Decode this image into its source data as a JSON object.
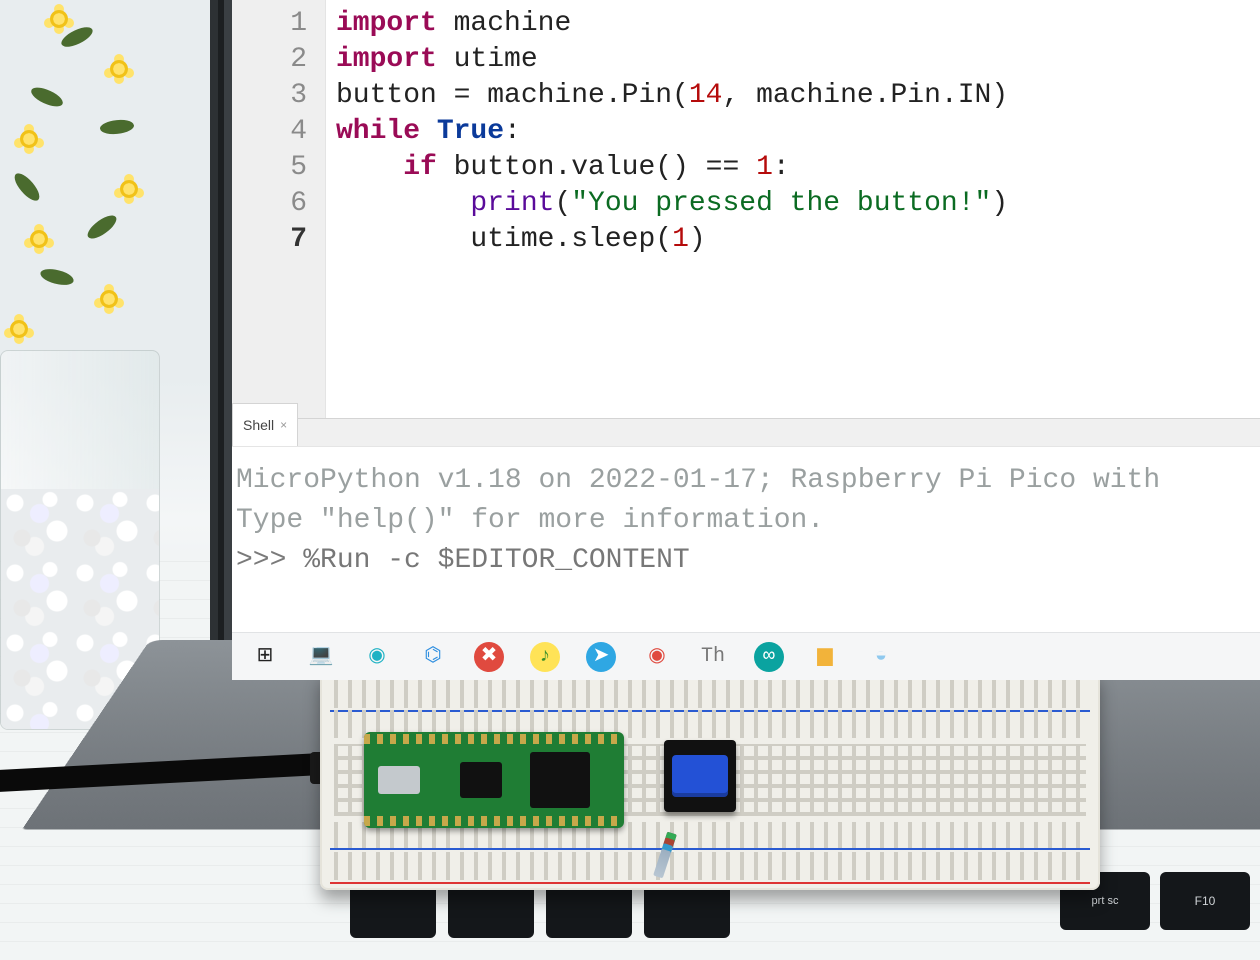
{
  "editor": {
    "current_line": 7,
    "lines": [
      {
        "n": 1,
        "tokens": [
          [
            "kw",
            "import"
          ],
          [
            "",
            " machine"
          ]
        ]
      },
      {
        "n": 2,
        "tokens": [
          [
            "kw",
            "import"
          ],
          [
            "",
            " utime"
          ]
        ]
      },
      {
        "n": 3,
        "tokens": [
          [
            "",
            "button = machine.Pin("
          ],
          [
            "num",
            "14"
          ],
          [
            "",
            ", machine.Pin.IN)"
          ]
        ]
      },
      {
        "n": 4,
        "tokens": [
          [
            "kw",
            "while"
          ],
          [
            "",
            " "
          ],
          [
            "bkw",
            "True"
          ],
          [
            "",
            ":"
          ]
        ]
      },
      {
        "n": 5,
        "tokens": [
          [
            "",
            "    "
          ],
          [
            "kw",
            "if"
          ],
          [
            "",
            " button.value() == "
          ],
          [
            "num",
            "1"
          ],
          [
            "",
            ":"
          ]
        ]
      },
      {
        "n": 6,
        "tokens": [
          [
            "",
            "        "
          ],
          [
            "fn",
            "print"
          ],
          [
            "",
            "("
          ],
          [
            "str",
            "\"You pressed the button!\""
          ],
          [
            "",
            ")"
          ]
        ]
      },
      {
        "n": 7,
        "tokens": [
          [
            "",
            "        utime.sleep("
          ],
          [
            "num",
            "1"
          ],
          [
            "",
            ")"
          ]
        ]
      }
    ]
  },
  "shell": {
    "tab_label": "Shell",
    "banner1": "MicroPython v1.18 on 2022-01-17; Raspberry Pi Pico with ",
    "banner2": "Type \"help()\" for more information.",
    "prompt_prefix": ">>> ",
    "prompt_cmd": "%Run -c $EDITOR_CONTENT"
  },
  "taskbar": {
    "items": [
      {
        "name": "start-icon",
        "glyph": "⊞",
        "color": "#222"
      },
      {
        "name": "laptop-icon",
        "glyph": "💻",
        "color": "#5aa7e8"
      },
      {
        "name": "edge-icon",
        "glyph": "◉",
        "color": "#1eb2c4"
      },
      {
        "name": "vscode-icon",
        "glyph": "⌬",
        "color": "#2f8fe0"
      },
      {
        "name": "close-app-icon",
        "glyph": "✖",
        "color": "#ffffff",
        "bg": "#e04a3f"
      },
      {
        "name": "music-icon",
        "glyph": "♪",
        "color": "#3a8f2a",
        "bg": "#ffe357"
      },
      {
        "name": "telegram-icon",
        "glyph": "➤",
        "color": "#ffffff",
        "bg": "#2fa7e3"
      },
      {
        "name": "chrome-icon",
        "glyph": "◉",
        "color": "#e04a3f"
      },
      {
        "name": "thonny-icon",
        "glyph": "Th",
        "color": "#777"
      },
      {
        "name": "arduino-icon",
        "glyph": "∞",
        "color": "#ffffff",
        "bg": "#0aa3a0"
      },
      {
        "name": "explorer-icon",
        "glyph": "▆",
        "color": "#f2b33a"
      },
      {
        "name": "cloud-icon",
        "glyph": "◒",
        "color": "#8fc9ef"
      }
    ]
  }
}
